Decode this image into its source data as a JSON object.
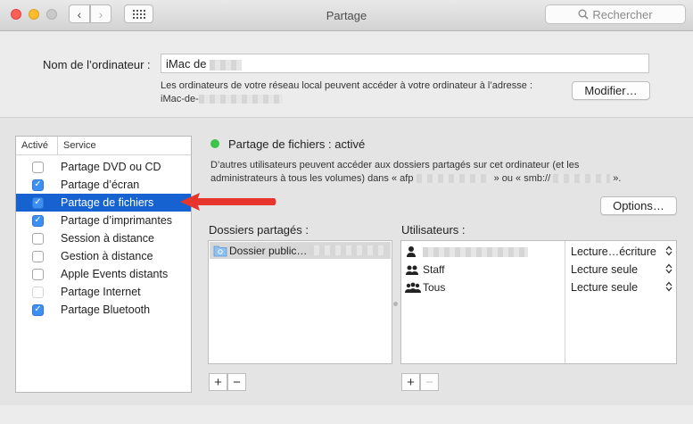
{
  "window": {
    "title": "Partage",
    "search_placeholder": "Rechercher"
  },
  "computer": {
    "name_label": "Nom de l’ordinateur :",
    "name_value": "iMac de",
    "info_text": "Les ordinateurs de votre réseau local peuvent accéder à votre ordinateur à l’adresse :",
    "address_prefix": "iMac-de-",
    "edit_button": "Modifier…"
  },
  "services": {
    "col_active": "Activé",
    "col_service": "Service",
    "items": [
      {
        "label": "Partage DVD ou CD",
        "checked": false,
        "selected": false
      },
      {
        "label": "Partage d’écran",
        "checked": true,
        "selected": false
      },
      {
        "label": "Partage de fichiers",
        "checked": true,
        "selected": true
      },
      {
        "label": "Partage d’imprimantes",
        "checked": true,
        "selected": false
      },
      {
        "label": "Session à distance",
        "checked": false,
        "selected": false
      },
      {
        "label": "Gestion à distance",
        "checked": false,
        "selected": false
      },
      {
        "label": "Apple Events distants",
        "checked": false,
        "selected": false
      },
      {
        "label": "Partage Internet",
        "checked": false,
        "selected": false
      },
      {
        "label": "Partage Bluetooth",
        "checked": true,
        "selected": false
      }
    ]
  },
  "detail": {
    "status": "Partage de fichiers : activé",
    "status_color": "#3cc34a",
    "desc_line1": "D’autres utilisateurs peuvent accéder aux dossiers partagés sur cet ordinateur (et les",
    "desc_line2_a": "administrateurs à tous les volumes) dans « afp",
    "desc_line2_b": "» ou « smb://",
    "desc_line2_c": "».",
    "options_button": "Options…",
    "folders_label": "Dossiers partagés :",
    "folder_item": "Dossier public…",
    "users_label": "Utilisateurs :",
    "users": [
      {
        "name": "",
        "icon": "user-icon",
        "permission": "Lecture…écriture"
      },
      {
        "name": "Staff",
        "icon": "group-icon",
        "permission": "Lecture seule"
      },
      {
        "name": "Tous",
        "icon": "everyone-icon",
        "permission": "Lecture seule"
      }
    ]
  },
  "colors": {
    "selection": "#1562d0",
    "checkbox_on": "#3d8ff2",
    "arrow": "#e8352b"
  }
}
